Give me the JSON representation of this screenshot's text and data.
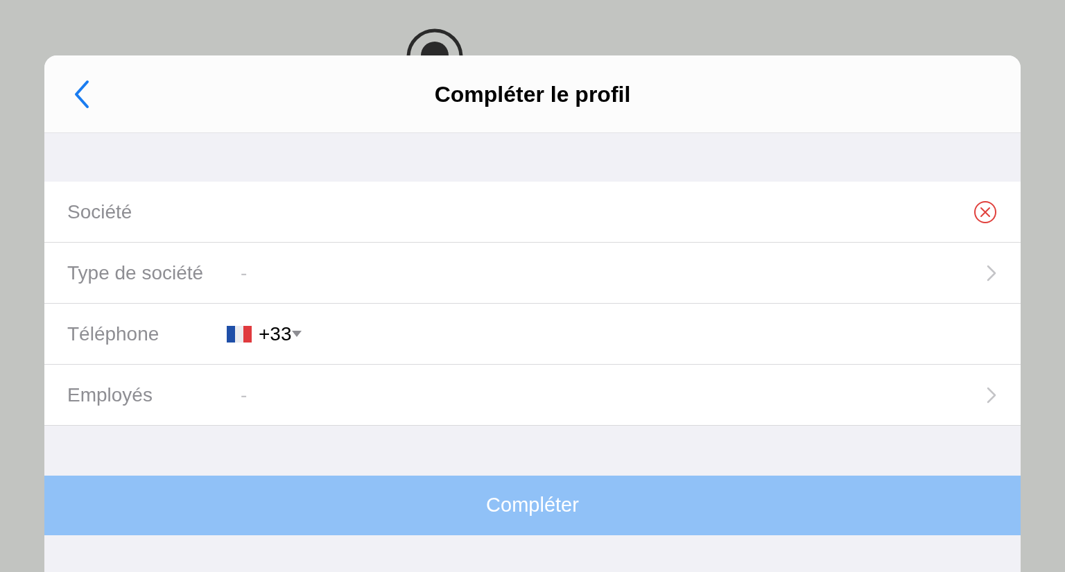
{
  "header": {
    "title": "Compléter le profil"
  },
  "fields": [
    {
      "kind": "text",
      "label": "Société",
      "error": true
    },
    {
      "kind": "picker",
      "label": "Type de société",
      "value": "-"
    },
    {
      "kind": "phone",
      "label": "Téléphone",
      "value": "+33"
    },
    {
      "kind": "picker",
      "label": "Employés",
      "value": "-"
    }
  ],
  "submit": {
    "label": "Compléter",
    "disabled": true
  }
}
